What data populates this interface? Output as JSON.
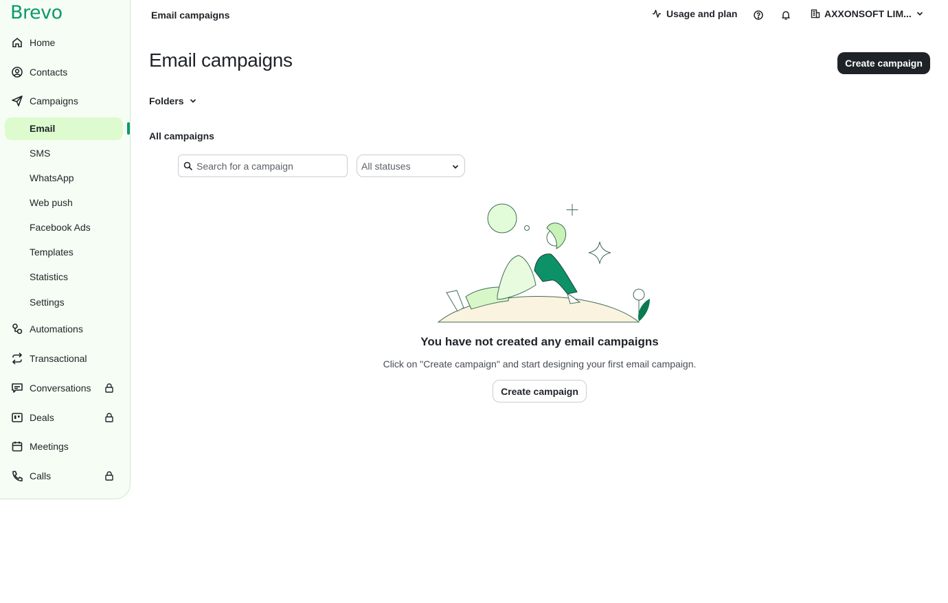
{
  "brand": {
    "logo_text": "Brevo",
    "accent_color": "#0b996e",
    "active_bg": "#ddfbce"
  },
  "header": {
    "page_label": "Email campaigns",
    "usage_label": "Usage and plan",
    "account_name": "AXXONSOFT LIM..."
  },
  "sidebar": {
    "items": [
      {
        "label": "Home",
        "icon": "home-icon"
      },
      {
        "label": "Contacts",
        "icon": "contacts-icon"
      },
      {
        "label": "Campaigns",
        "icon": "paper-plane-icon"
      },
      {
        "label": "Automations",
        "icon": "automations-icon"
      },
      {
        "label": "Transactional",
        "icon": "transactional-icon"
      },
      {
        "label": "Conversations",
        "icon": "chat-icon",
        "locked": true
      },
      {
        "label": "Deals",
        "icon": "deals-icon",
        "locked": true
      },
      {
        "label": "Meetings",
        "icon": "calendar-icon"
      },
      {
        "label": "Calls",
        "icon": "phone-icon",
        "locked": true
      }
    ],
    "campaign_sub": [
      {
        "label": "Email",
        "active": true
      },
      {
        "label": "SMS"
      },
      {
        "label": "WhatsApp"
      },
      {
        "label": "Web push"
      },
      {
        "label": "Facebook Ads"
      },
      {
        "label": "Templates"
      },
      {
        "label": "Statistics"
      },
      {
        "label": "Settings"
      }
    ]
  },
  "main": {
    "title": "Email campaigns",
    "create_button": "Create campaign",
    "folders_label": "Folders",
    "section_title": "All campaigns",
    "search_placeholder": "Search for a campaign",
    "status_selected": "All statuses",
    "empty_title": "You have not created any email campaigns",
    "empty_description": "Click on \"Create campaign\" and start designing your first email campaign.",
    "empty_button": "Create campaign"
  }
}
